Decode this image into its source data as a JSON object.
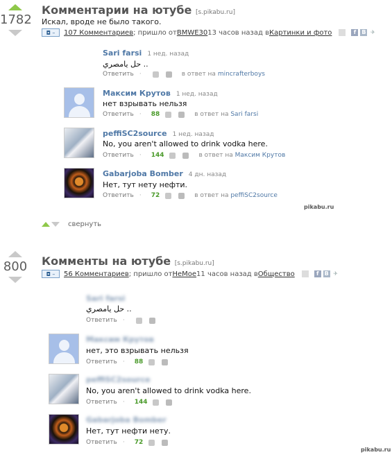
{
  "posts": [
    {
      "score": "1782",
      "title": "Комментарии на ютубе",
      "source": "[s.pikabu.ru]",
      "description": "Искал, вроде не было такого.",
      "meta": {
        "comments": "107 Комментариев",
        "came_from": "; пришло от ",
        "author": "BMWE30",
        "time": " 13 часов назад в ",
        "category": "Картинки и фото"
      },
      "comments": [
        {
          "name": "Sari farsi",
          "ago": "1 нед. назад",
          "text": "حل يامصري ..",
          "reply": "Ответить",
          "count": "",
          "in_reply": "в ответ на ",
          "reply_to": "mincrafterboys"
        },
        {
          "name": "Максим Крутов",
          "ago": "1 нед. назад",
          "text": "нет взрывать нельзя",
          "reply": "Ответить",
          "count": "88",
          "in_reply": "в ответ на ",
          "reply_to": "Sari farsi"
        },
        {
          "name": "peffiSC2source",
          "ago": "1 нед. назад",
          "text": "No, you aren't allowed to drink vodka here.",
          "reply": "Ответить",
          "count": "144",
          "in_reply": "в ответ на ",
          "reply_to": "Максим Крутов"
        },
        {
          "name": "Gabarjoba Bomber",
          "ago": "4 дн. назад",
          "text": "Нет, тут нету нефти.",
          "reply": "Ответить",
          "count": "72",
          "in_reply": "в ответ на ",
          "reply_to": "peffiSC2source"
        }
      ],
      "watermark": "pikabu.ru",
      "collapse_label": "свернуть"
    },
    {
      "score": "800",
      "title": "Комменты на ютубе",
      "source": "[s.pikabu.ru]",
      "meta": {
        "comments": "56 Комментариев",
        "came_from": "; пришло от ",
        "author": "НеМое",
        "time": " 11 часов назад в ",
        "category": "Общество"
      },
      "comments": [
        {
          "name": "Sari farsi",
          "text": "حل يامصري ..",
          "reply": "Ответить",
          "count": ""
        },
        {
          "name": "Максим Крутов",
          "text": "нет, это взрывать нельзя",
          "reply": "Ответить",
          "count": "88"
        },
        {
          "name": "peffiSC2source",
          "text": "No, you aren't allowed to drink vodka here.",
          "reply": "Ответить",
          "count": "144"
        },
        {
          "name": "Gabarjoba Bomber",
          "text": "Нет, тут нефти нету.",
          "reply": "Ответить",
          "count": "72"
        }
      ],
      "watermark": "pikabu.ru"
    }
  ],
  "colors": {
    "accent": "#4f78a6",
    "upvote": "#8fc84a",
    "count": "#4a9a2a"
  }
}
